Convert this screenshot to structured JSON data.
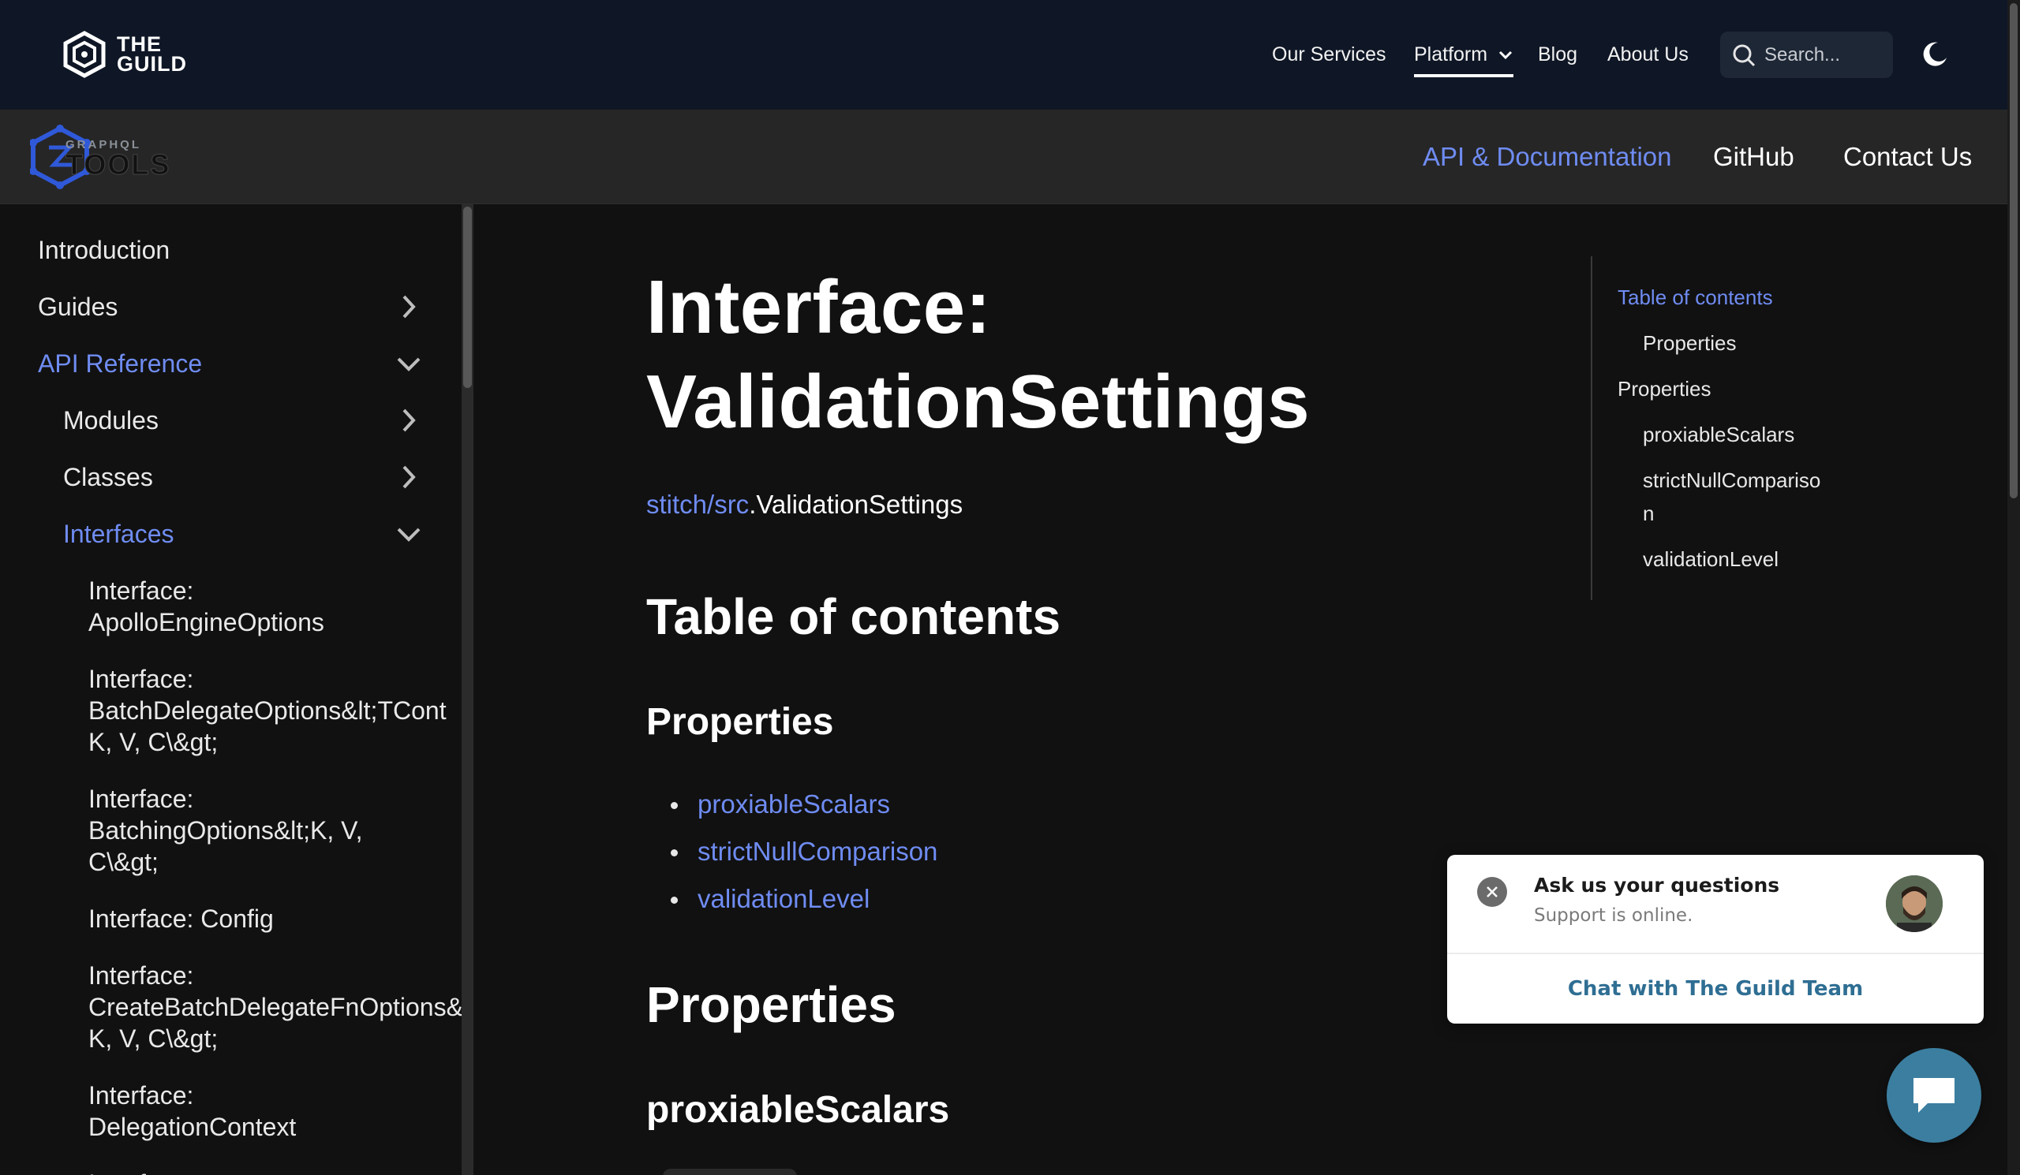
{
  "topnav": {
    "logo_text_line1": "THE",
    "logo_text_line2": "GUILD",
    "links": [
      "Our Services",
      "Platform",
      "Blog",
      "About Us"
    ],
    "search_placeholder": "Search...",
    "icons": {
      "logo": "guild-hexagon-icon",
      "dropdown": "chevron-down-icon",
      "search": "search-icon",
      "theme": "moon-icon"
    }
  },
  "subnav": {
    "logo_small": "GRAPHQL",
    "logo_big": "TOOLS",
    "links": [
      "API & Documentation",
      "GitHub",
      "Contact Us"
    ],
    "accent_color": "#6f8cf2"
  },
  "sidebar": {
    "items": [
      {
        "label": "Introduction"
      },
      {
        "label": "Guides",
        "icon": "chevron-right-icon"
      },
      {
        "label": "API Reference",
        "icon": "chevron-down-icon",
        "active": true
      },
      {
        "label": "Modules",
        "icon": "chevron-right-icon"
      },
      {
        "label": "Classes",
        "icon": "chevron-right-icon"
      },
      {
        "label": "Interfaces",
        "icon": "chevron-down-icon",
        "active": true
      }
    ],
    "interfaces": [
      "Interface:\nApolloEngineOptions",
      "Interface:\nBatchDelegateOptions&lt;TCont\nK, V, C\\&gt;",
      "Interface:\nBatchingOptions&lt;K, V,\nC\\&gt;",
      "Interface: Config",
      "Interface:\nCreateBatchDelegateFnOptions&\nK, V, C\\&gt;",
      "Interface:\nDelegationContext",
      "Interface:"
    ]
  },
  "main": {
    "title_line1": "Interface:",
    "title_line2": "ValidationSettings",
    "breadcrumb_link": "stitch/src",
    "breadcrumb_rest": ".ValidationSettings",
    "toc_heading": "Table of contents",
    "properties_subheading": "Properties",
    "property_links": [
      "proxiableScalars",
      "strictNullComparison",
      "validationLevel"
    ],
    "properties_heading": "Properties",
    "first_property": "proxiableScalars"
  },
  "toc": {
    "items": [
      {
        "label": "Table of contents",
        "level": 0,
        "active": true
      },
      {
        "label": "Properties",
        "level": 1
      },
      {
        "label": "Properties",
        "level": 0
      },
      {
        "label": "proxiableScalars",
        "level": 1
      },
      {
        "label": "strictNullCompariso",
        "level": 1
      },
      {
        "label": "n",
        "level": 1
      },
      {
        "label": "validationLevel",
        "level": 1
      }
    ]
  },
  "chat": {
    "title": "Ask us your questions",
    "status": "Support is online.",
    "cta": "Chat with The Guild Team",
    "brand_color": "#2f6e93",
    "icons": {
      "close": "close-icon",
      "avatar": "support-avatar",
      "fab": "chat-bubble-icon"
    }
  }
}
